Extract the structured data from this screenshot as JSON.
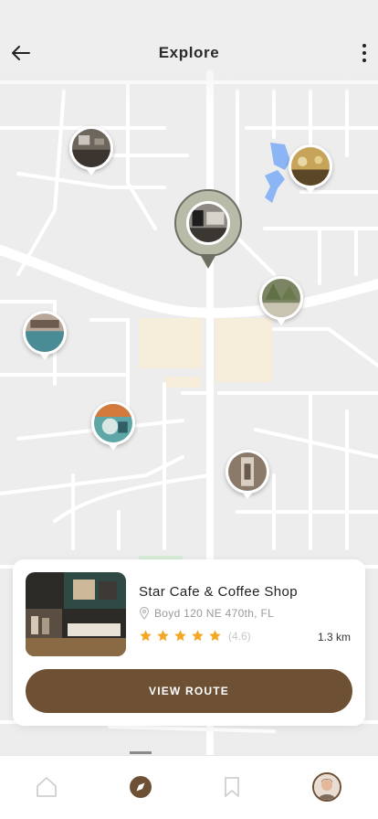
{
  "header": {
    "title": "Explore",
    "back_icon": "arrow-left-icon",
    "menu_icon": "more-vertical-icon"
  },
  "map": {
    "background": "#ededed",
    "road": "#ffffff",
    "water": "#8bb5f5",
    "landmark": "#f6eedb"
  },
  "card": {
    "name": "Star Cafe & Coffee Shop",
    "address": "Boyd 120 NE 470th, FL",
    "stars": 5,
    "rating": "(4.6)",
    "distance": "1.3 km",
    "button_label": "VIEW ROUTE"
  },
  "colors": {
    "accent": "#6e5035",
    "star": "#f5a623"
  },
  "tabs": [
    {
      "name": "home",
      "icon": "home-icon",
      "active": false
    },
    {
      "name": "explore",
      "icon": "compass-icon",
      "active": true
    },
    {
      "name": "saved",
      "icon": "bookmark-icon",
      "active": false
    },
    {
      "name": "profile",
      "icon": "avatar",
      "active": false
    }
  ]
}
